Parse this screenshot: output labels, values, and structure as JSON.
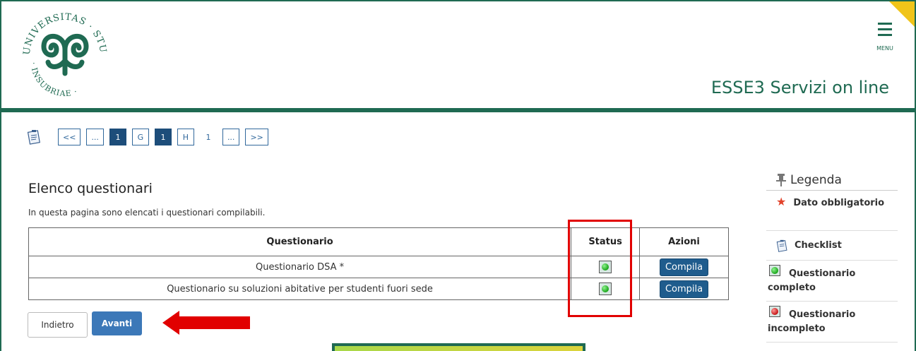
{
  "header": {
    "site_title": "ESSE3 Servizi on line",
    "menu_label": "MENU",
    "logo_text": "UNIVERSITAS STUDIORUM INSUBRIAE"
  },
  "pager": {
    "first": "<<",
    "ellipsis_left": "...",
    "page_1a": "1",
    "g": "G",
    "page_1b": "1",
    "h": "H",
    "page_1c": "1",
    "ellipsis_right": "...",
    "last": ">>"
  },
  "main": {
    "title": "Elenco questionari",
    "intro": "In questa pagina sono elencati i questionari compilabili.",
    "table": {
      "headers": [
        "Questionario",
        "Status",
        "Azioni"
      ],
      "rows": [
        {
          "questionario": "Questionario DSA *",
          "status": "completo",
          "action": "Compila"
        },
        {
          "questionario": "Questionario su soluzioni abitative per studenti fuori sede",
          "status": "completo",
          "action": "Compila"
        }
      ]
    },
    "back_label": "Indietro",
    "next_label": "Avanti"
  },
  "legend": {
    "title": "Legenda",
    "required": "Dato obbligatorio",
    "checklist": "Checklist",
    "complete": "Questionario completo",
    "incomplete": "Questionario incompleto"
  },
  "colors": {
    "brand_green": "#1f6a52",
    "button_blue": "#1f5c8d",
    "highlight_red": "#e10000",
    "corner_yellow": "#f0c419"
  }
}
